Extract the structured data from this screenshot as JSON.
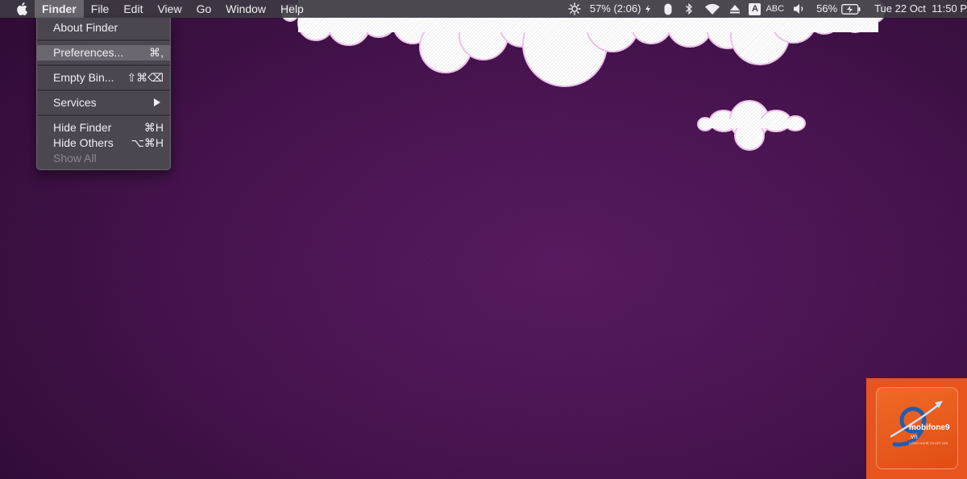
{
  "menubar": {
    "apple_icon": "apple-logo-icon",
    "items": [
      {
        "label": "Finder",
        "active": true
      },
      {
        "label": "File"
      },
      {
        "label": "Edit"
      },
      {
        "label": "View"
      },
      {
        "label": "Go"
      },
      {
        "label": "Window"
      },
      {
        "label": "Help"
      }
    ]
  },
  "status": {
    "brightness_icon": "brightness-icon",
    "battery_time": "57% (2:06)",
    "charging_icon": "bolt-icon",
    "mouse_icon": "mouse-icon",
    "bluetooth_icon": "bluetooth-icon",
    "wifi_icon": "wifi-icon",
    "eject_icon": "eject-icon",
    "input_source_badge": "A",
    "input_source_label": "ABC",
    "volume_icon": "volume-icon",
    "battery_percent": "56%",
    "battery_icon": "battery-charging-icon",
    "datetime": "Tue 22 Oct  11:50 P"
  },
  "finder_menu": {
    "items": [
      {
        "label": "About Finder",
        "shortcut": ""
      },
      {
        "label": "Preferences...",
        "shortcut": "⌘,",
        "highlighted": true
      },
      {
        "label": "Empty Bin...",
        "shortcut": "⇧⌘⌫"
      },
      {
        "label": "Services",
        "shortcut": "",
        "submenu": true
      },
      {
        "label": "Hide Finder",
        "shortcut": "⌘H"
      },
      {
        "label": "Hide Others",
        "shortcut": "⌥⌘H"
      },
      {
        "label": "Show All",
        "shortcut": "",
        "disabled": true
      }
    ]
  },
  "watermark": {
    "brand": "mobifone9",
    "domain": ".vn",
    "tagline": "CÔNG NGHỆ VÀ KẾT NỐI"
  },
  "colors": {
    "wallpaper": "#3e1145",
    "menubar": "#3e3a42",
    "menu_highlight": "#6b6770",
    "watermark_bg": "#e8541e"
  }
}
